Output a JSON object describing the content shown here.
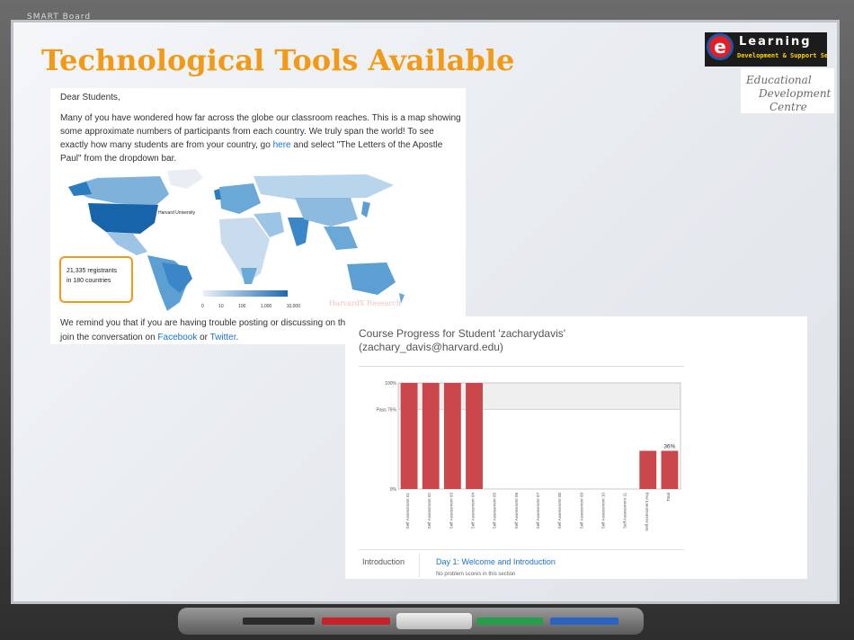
{
  "brand": "SMART Board",
  "slide": {
    "title": "Technological Tools Available",
    "logo1": {
      "big": "Learning",
      "small": "Development & Support Section"
    },
    "logo2": {
      "line1": "Educational",
      "line2": "Development",
      "line3": "Centre"
    }
  },
  "letter": {
    "greeting": "Dear Students,",
    "para_a": "Many of you have wondered how far across the globe our classroom reaches. This is a map showing some approximate numbers of participants from each country. We truly span the world! To see exactly how many students are from your country, go ",
    "link_here": "here",
    "para_b": " and select \"The Letters of the Apostle Paul\" from the dropdown bar.",
    "map_label": "Harvard University",
    "registrants": "21,335 registrants",
    "countries": "in 180 countries",
    "scale_labels": [
      "0",
      "10",
      "100",
      "1,000",
      "10,000"
    ],
    "credit": "HarvardX Research",
    "remind": "We remind you that if you are having trouble posting or discussing on the dis",
    "join_a": "join the conversation on ",
    "facebook": "Facebook",
    "or": " or ",
    "twitter": "Twitter",
    "end": "."
  },
  "progress": {
    "title_line1": "Course Progress for Student 'zacharydavis'",
    "title_line2": "(zachary_davis@harvard.edu)",
    "section_label": "Introduction",
    "section_link": "Day 1: Welcome and Introduction",
    "section_note": "No problem scores in this section"
  },
  "chart_data": {
    "type": "bar",
    "categories": [
      "Self Assessment 01",
      "Self Assessment 02",
      "Self Assessment 03",
      "Self Assessment 04",
      "Self Assessment 05",
      "Self Assessment 06",
      "Self Assessment 07",
      "Self Assessment 08",
      "Self Assessment 09",
      "Self Assessment 10",
      "Self Assessment 11",
      "Self Assessment Avg",
      "Total"
    ],
    "values": [
      100,
      100,
      100,
      100,
      0,
      0,
      0,
      0,
      0,
      0,
      0,
      36,
      36
    ],
    "y_ticks": [
      "100%",
      "Pass 75%",
      "0%"
    ],
    "pass_line": 75,
    "ylim": [
      0,
      100
    ],
    "data_label": "36%",
    "bar_color": "#c9464a"
  }
}
